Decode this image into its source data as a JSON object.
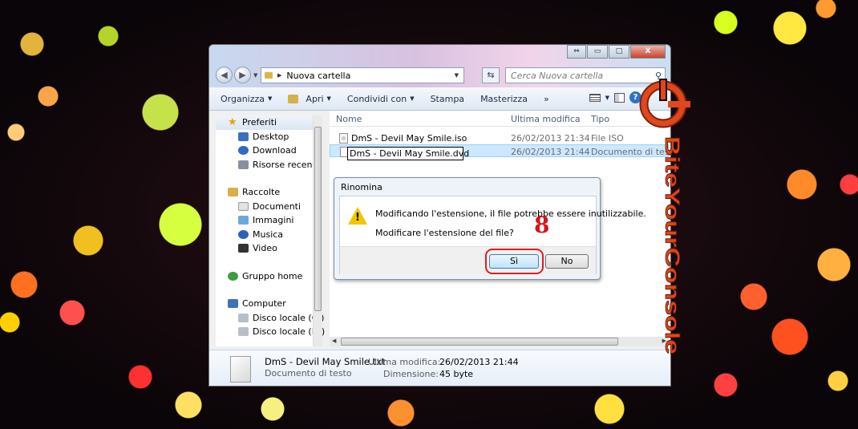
{
  "window": {
    "controls": {
      "restore": "⇔",
      "minimize": "▭",
      "maximize": "□",
      "close": "X"
    },
    "address": "Nuova cartella",
    "search_placeholder": "Cerca Nuova cartella"
  },
  "toolbar": {
    "organizza": "Organizza",
    "apri": "Apri",
    "condividi": "Condividi con",
    "stampa": "Stampa",
    "masterizza": "Masterizza",
    "more": "»"
  },
  "sidebar": {
    "preferiti": "Preferiti",
    "desktop": "Desktop",
    "download": "Download",
    "risorse": "Risorse recenti",
    "raccolte": "Raccolte",
    "documenti": "Documenti",
    "immagini": "Immagini",
    "musica": "Musica",
    "video": "Video",
    "gruppo": "Gruppo home",
    "computer": "Computer",
    "disco_c": "Disco locale (C:)",
    "disco_d": "Disco locale (D:)"
  },
  "columns": {
    "name": "Nome",
    "modified": "Ultima modifica",
    "type": "Tipo"
  },
  "files": [
    {
      "name": "DmS - Devil May Smile.iso",
      "date": "26/02/2013 21:34",
      "type": "File ISO"
    },
    {
      "name": "DmS - Devil May Smile.dvd",
      "date": "26/02/2013 21:44",
      "type": "Documento di testo"
    }
  ],
  "details": {
    "filename": "DmS - Devil May Smile.txt",
    "filetype": "Documento di testo",
    "modified_label": "Ultima modifica:",
    "modified_value": "26/02/2013 21:44",
    "size_label": "Dimensione:",
    "size_value": "45 byte"
  },
  "dialog": {
    "title": "Rinomina",
    "message1": "Modificando l'estensione, il file potrebbe essere inutilizzabile.",
    "message2": "Modificare l'estensione del file?",
    "yes": "Sì",
    "no": "No"
  },
  "annotation": {
    "step": "8"
  },
  "brand": {
    "logo_text": "BiteYourConsole",
    "color": "#e0471a"
  }
}
